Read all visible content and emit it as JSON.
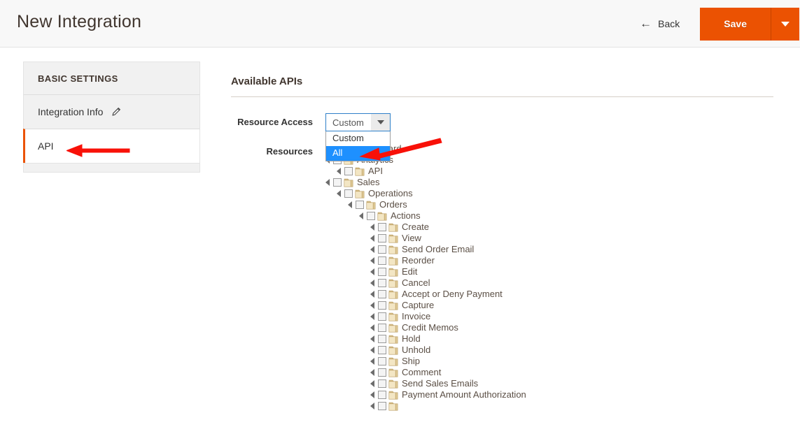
{
  "header": {
    "title": "New Integration",
    "back_label": "Back",
    "back_icon": "arrow-left-icon",
    "save_label": "Save",
    "save_toggle_icon": "chevron-down-icon",
    "accent_color": "#eb5202"
  },
  "sidebar": {
    "heading": "BASIC SETTINGS",
    "items": [
      {
        "label": "Integration Info",
        "icon": "pencil-icon",
        "active": false
      },
      {
        "label": "API",
        "icon": "",
        "active": true
      }
    ]
  },
  "main": {
    "section_title": "Available APIs",
    "fields": {
      "resource_access_label": "Resource Access",
      "resources_label": "Resources"
    },
    "resource_access": {
      "value": "Custom",
      "expanded": true,
      "dropdown_icon": "chevron-down-icon",
      "options": [
        {
          "label": "Custom",
          "selected": false
        },
        {
          "label": "All",
          "selected": true
        }
      ]
    }
  },
  "tree": {
    "expander_icon": "triangle-right-icon",
    "node_icon": "folder-icon",
    "nodes": [
      {
        "label": "Dashboard",
        "depth": 0,
        "checked": false
      },
      {
        "label": "Analytics",
        "depth": 0,
        "checked": false
      },
      {
        "label": "API",
        "depth": 1,
        "checked": false
      },
      {
        "label": "Sales",
        "depth": 0,
        "checked": false
      },
      {
        "label": "Operations",
        "depth": 1,
        "checked": false
      },
      {
        "label": "Orders",
        "depth": 2,
        "checked": false
      },
      {
        "label": "Actions",
        "depth": 3,
        "checked": false
      },
      {
        "label": "Create",
        "depth": 4,
        "checked": false
      },
      {
        "label": "View",
        "depth": 4,
        "checked": false
      },
      {
        "label": "Send Order Email",
        "depth": 4,
        "checked": false
      },
      {
        "label": "Reorder",
        "depth": 4,
        "checked": false
      },
      {
        "label": "Edit",
        "depth": 4,
        "checked": false
      },
      {
        "label": "Cancel",
        "depth": 4,
        "checked": false
      },
      {
        "label": "Accept or Deny Payment",
        "depth": 4,
        "checked": false
      },
      {
        "label": "Capture",
        "depth": 4,
        "checked": false
      },
      {
        "label": "Invoice",
        "depth": 4,
        "checked": false
      },
      {
        "label": "Credit Memos",
        "depth": 4,
        "checked": false
      },
      {
        "label": "Hold",
        "depth": 4,
        "checked": false
      },
      {
        "label": "Unhold",
        "depth": 4,
        "checked": false
      },
      {
        "label": "Ship",
        "depth": 4,
        "checked": false
      },
      {
        "label": "Comment",
        "depth": 4,
        "checked": false
      },
      {
        "label": "Send Sales Emails",
        "depth": 4,
        "checked": false
      },
      {
        "label": "Payment Amount Authorization",
        "depth": 4,
        "checked": false
      },
      {
        "label": "",
        "depth": 4,
        "checked": false
      }
    ]
  },
  "annotations": [
    {
      "name": "arrow-pointing-to-api-tab",
      "color": "#f81108"
    },
    {
      "name": "arrow-pointing-to-all-option",
      "color": "#f81108"
    }
  ]
}
